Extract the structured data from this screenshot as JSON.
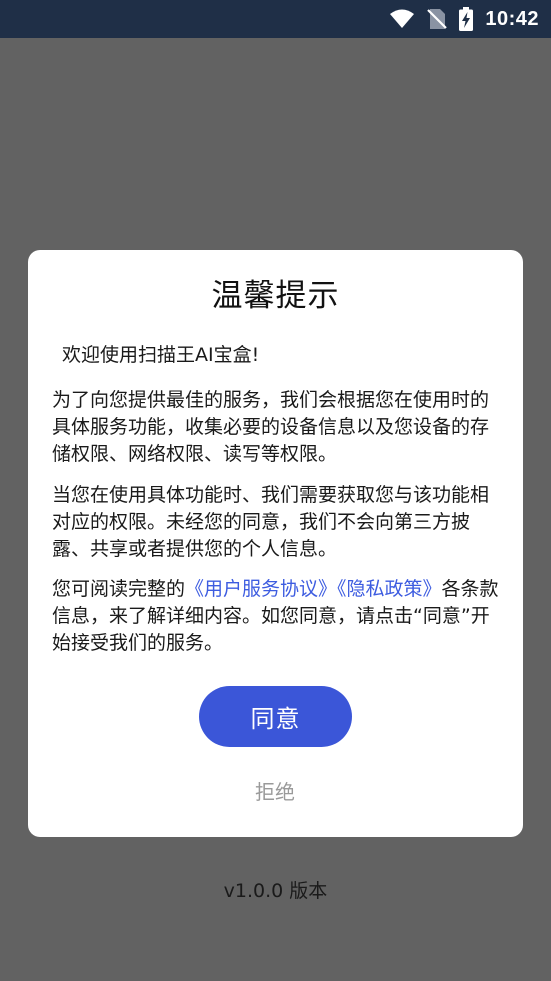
{
  "status_bar": {
    "time": "10:42",
    "icons": [
      "wifi-icon",
      "no-sim-icon",
      "battery-charging-icon"
    ]
  },
  "dialog": {
    "title": "温馨提示",
    "welcome": "欢迎使用扫描王AI宝盒!",
    "para1": "为了向您提供最佳的服务，我们会根据您在使用时的具体服务功能，收集必要的设备信息以及您设备的存储权限、网络权限、读写等权限。",
    "para2": "当您在使用具体功能时、我们需要获取您与该功能相对应的权限。未经您的同意，我们不会向第三方披露、共享或者提供您的个人信息。",
    "para3_prefix": "您可阅读完整的",
    "user_agreement_link": "《用户服务协议》",
    "privacy_policy_link": "《隐私政策》",
    "para3_suffix": "各条款信息，来了解详细内容。如您同意，请点击“同意”开始接受我们的服务。",
    "agree_label": "同意",
    "reject_label": "拒绝"
  },
  "footer": {
    "version": "v1.0.0 版本"
  },
  "colors": {
    "status_bar_bg": "#1f2f47",
    "overlay_bg": "#626262",
    "accent": "#3b56d8",
    "link": "#3d5ce0",
    "muted": "#9a9a9a"
  }
}
